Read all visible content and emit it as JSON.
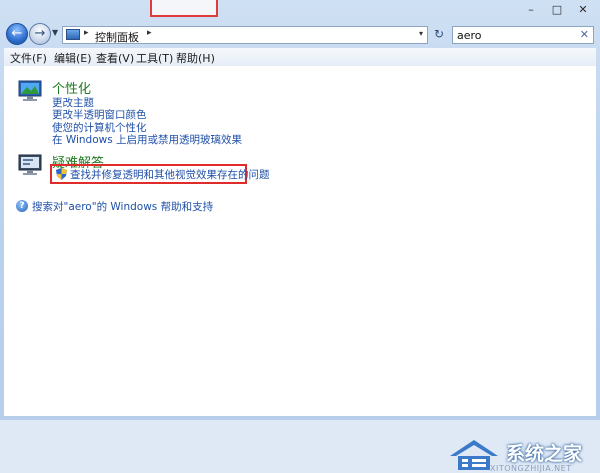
{
  "window": {
    "minimize_glyph": "–",
    "maximize_glyph": "□",
    "close_glyph": "✕"
  },
  "address_bar": {
    "separator": "▸",
    "path": "控制面板",
    "drop_glyph": "▾"
  },
  "search": {
    "value": "aero",
    "clear_glyph": "✕"
  },
  "menu": {
    "items": [
      {
        "label": "文件(F)"
      },
      {
        "label": "编辑(E)"
      },
      {
        "label": "查看(V)"
      },
      {
        "label": "工具(T)"
      },
      {
        "label": "帮助(H)"
      }
    ]
  },
  "results": {
    "personalization": {
      "title": "个性化",
      "links": [
        "更改主题",
        "更改半透明窗口颜色",
        "使您的计算机个性化",
        "在 Windows 上启用或禁用透明玻璃效果"
      ]
    },
    "troubleshooting": {
      "title": "疑难解答",
      "links": [
        "查找并修复透明和其他视觉效果存在的问题"
      ]
    },
    "help_link": "搜索对\"aero\"的 Windows 帮助和支持"
  },
  "watermark": {
    "name": "系统之家",
    "domain": "XITONGZHIJIA.NET"
  },
  "icons": {
    "back": "back-arrow-icon",
    "forward": "forward-arrow-icon",
    "refresh": "refresh-icon",
    "personalization": "personalization-monitor-icon",
    "troubleshooting": "troubleshooting-monitor-icon",
    "shield": "uac-shield-icon",
    "help": "help-icon"
  },
  "colors": {
    "category_title": "#1e7a1e",
    "link": "#1f4fa8",
    "highlight_border": "#e02b2b"
  }
}
